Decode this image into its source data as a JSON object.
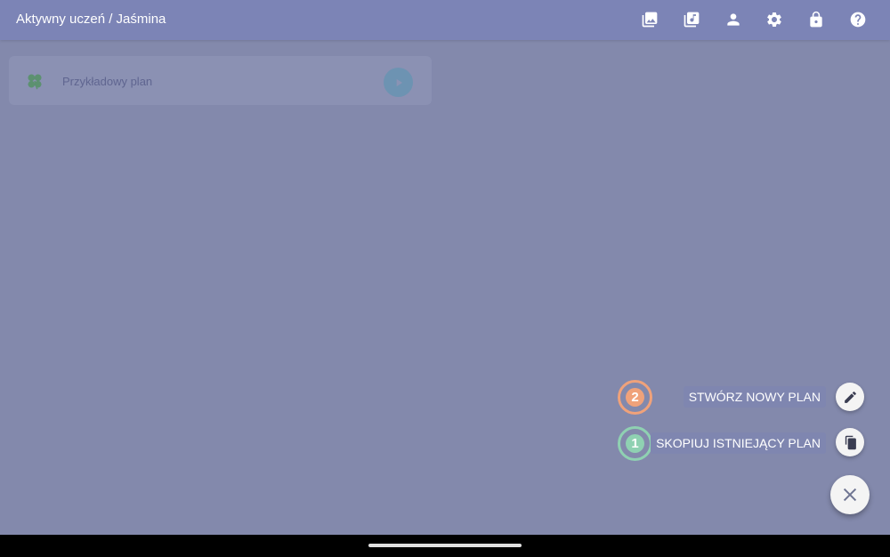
{
  "header": {
    "title": "Aktywny uczeń / Jaśmina",
    "icons": [
      "gallery-icon",
      "music-library-icon",
      "person-icon",
      "settings-icon",
      "lock-icon",
      "help-icon"
    ]
  },
  "plans": [
    {
      "label": "Przykładowy plan",
      "icon": "clover-icon",
      "action_icon": "play-icon"
    }
  ],
  "fab_menu": {
    "new_plan": {
      "step": "2",
      "label": "STWÓRZ NOWY PLAN",
      "icon": "pencil-icon",
      "badge_color": "#F0A27A"
    },
    "copy_plan": {
      "step": "1",
      "label": "SKOPIUJ ISTNIEJĄCY PLAN",
      "icon": "copy-icon",
      "badge_color": "#8FD1B2"
    },
    "close_icon": "close-icon"
  },
  "colors": {
    "topbar": "#7C84B6",
    "overlay": "#8389AC",
    "fab": "#F4F4F4"
  }
}
